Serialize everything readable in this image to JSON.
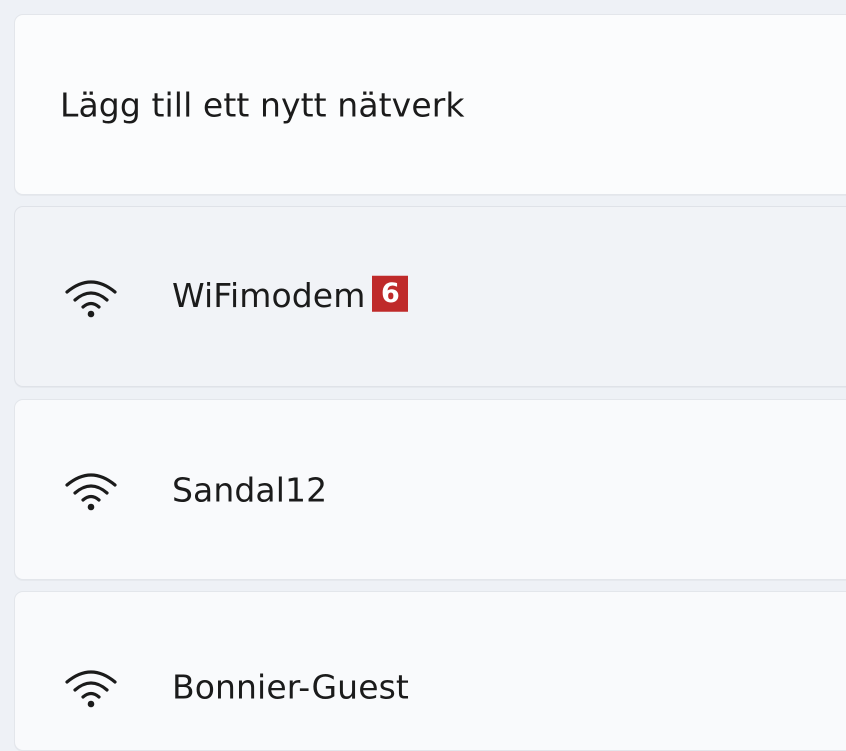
{
  "add_network": {
    "label": "Lägg till ett nytt nätverk"
  },
  "networks": [
    {
      "ssid": "WiFimodem",
      "badge": "6",
      "icon": "wifi-signal-icon",
      "selected": true
    },
    {
      "ssid": "Sandal12",
      "icon": "wifi-signal-icon",
      "selected": false
    },
    {
      "ssid": "Bonnier-Guest",
      "icon": "wifi-signal-icon",
      "selected": false
    }
  ],
  "colors": {
    "background": "#eef1f6",
    "card": "#f9fafc",
    "selected_card": "#f1f3f7",
    "badge": "#bf2a2a"
  }
}
